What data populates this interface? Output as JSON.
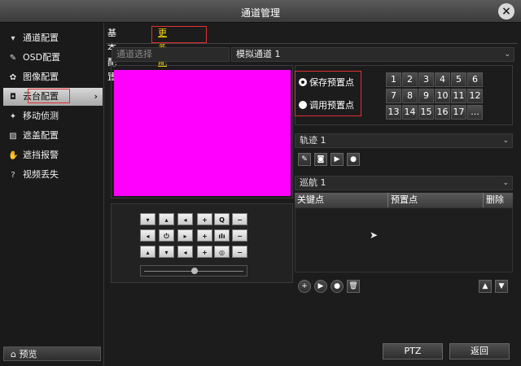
{
  "window": {
    "title": "通道管理",
    "close_icon": "×"
  },
  "sidebar": {
    "items": [
      {
        "label": "通道配置",
        "icon": "camera-icon",
        "glyph": "▾"
      },
      {
        "label": "OSD配置",
        "icon": "osd-icon",
        "glyph": "✎"
      },
      {
        "label": "图像配置",
        "icon": "image-icon",
        "glyph": "✿"
      },
      {
        "label": "云台配置",
        "icon": "ptz-icon",
        "glyph": "◘"
      },
      {
        "label": "移动侦测",
        "icon": "motion-icon",
        "glyph": "✦"
      },
      {
        "label": "遮盖配置",
        "icon": "mask-icon",
        "glyph": "▨"
      },
      {
        "label": "遮挡报警",
        "icon": "alarm-hand-icon",
        "glyph": "✋"
      },
      {
        "label": "视频丢失",
        "icon": "video-loss-icon",
        "glyph": "?"
      }
    ],
    "active_arrow": "›",
    "preview_label": "预览",
    "preview_glyph": "⌂"
  },
  "tabs": {
    "basic": "基本配置",
    "more": "更多配置"
  },
  "channel": {
    "label": "通道选择",
    "value": "模拟通道 1",
    "dropdown": "⌄"
  },
  "ptz_controls": {
    "row1": [
      "▾",
      "▴",
      "◂",
      "+",
      "Q",
      "−"
    ],
    "row2": [
      "◂",
      "⏻",
      "▸",
      "+",
      "ılı",
      "−"
    ],
    "row3": [
      "▴",
      "▾",
      "◂",
      "+",
      "◎",
      "−"
    ]
  },
  "preset": {
    "save": "保存预置点",
    "call": "调用预置点",
    "numbers": [
      "1",
      "2",
      "3",
      "4",
      "5",
      "6",
      "7",
      "8",
      "9",
      "10",
      "11",
      "12",
      "13",
      "14",
      "15",
      "16",
      "17",
      "..."
    ]
  },
  "track": {
    "value": "轨迹 1",
    "dropdown": "⌄",
    "buttons": [
      "✎",
      "◙",
      "▶",
      "●"
    ]
  },
  "cruise": {
    "value": "巡航 1",
    "dropdown": "⌄",
    "columns": [
      "关键点",
      "预置点",
      "删除"
    ],
    "buttons_left": [
      "+",
      "▶",
      "●",
      "🗑"
    ],
    "buttons_right": [
      "▲",
      "▼"
    ]
  },
  "footer": {
    "ptz": "PTZ",
    "back": "返回"
  },
  "colors": {
    "video": "#ff00ff",
    "highlight": "#e03030",
    "tab_active": "#f5d400"
  }
}
